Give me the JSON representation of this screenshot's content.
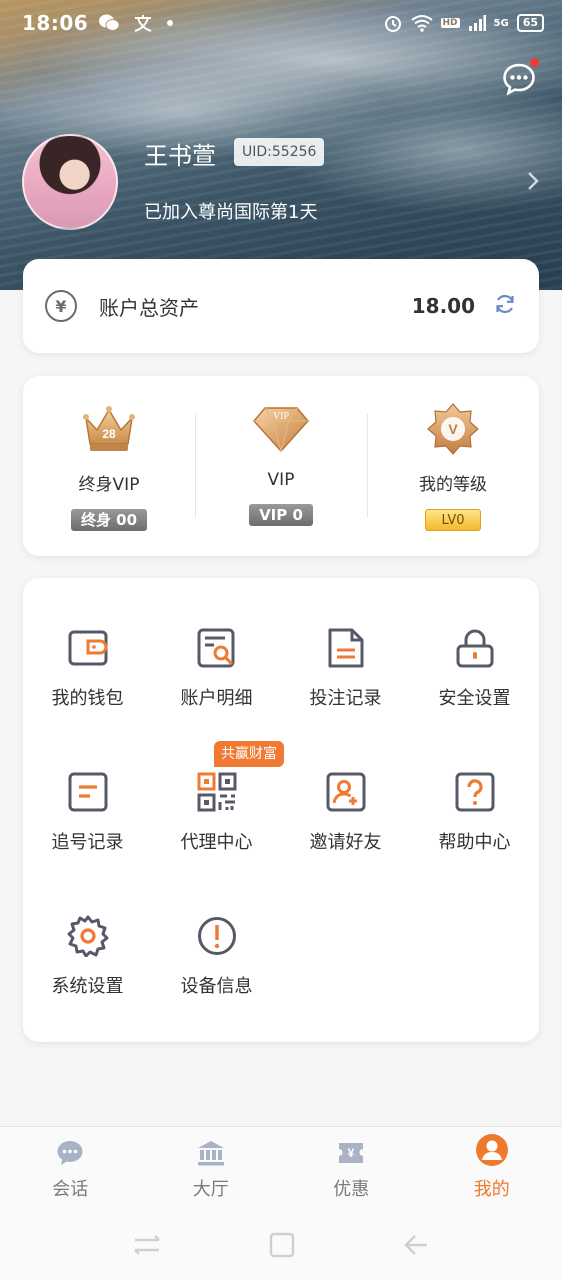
{
  "status_bar": {
    "time": "18:06",
    "network": "5G",
    "battery": "65",
    "hd_label": "HD"
  },
  "profile": {
    "name": "王书萱",
    "uid": "UID:55256",
    "joined_text": "已加入尊尚国际第1天"
  },
  "assets": {
    "label": "账户总资产",
    "value": "18.00",
    "icon": "yen-icon"
  },
  "vip": [
    {
      "label": "终身VIP",
      "badge": "终身 00",
      "icon": "crown-icon",
      "icon_text": "28"
    },
    {
      "label": "VIP",
      "badge": "VIP 0",
      "icon": "diamond-icon",
      "icon_text": "VIP"
    },
    {
      "label": "我的等级",
      "badge": "LV0",
      "icon": "level-badge-icon",
      "icon_text": "V"
    }
  ],
  "menu": {
    "items": [
      {
        "label": "我的钱包",
        "icon": "wallet-icon"
      },
      {
        "label": "账户明细",
        "icon": "account-details-icon"
      },
      {
        "label": "投注记录",
        "icon": "document-icon"
      },
      {
        "label": "安全设置",
        "icon": "lock-icon"
      },
      {
        "label": "追号记录",
        "icon": "chase-record-icon"
      },
      {
        "label": "代理中心",
        "icon": "qr-code-icon",
        "badge": "共赢财富"
      },
      {
        "label": "邀请好友",
        "icon": "invite-user-icon"
      },
      {
        "label": "帮助中心",
        "icon": "help-icon"
      },
      {
        "label": "系统设置",
        "icon": "gear-icon"
      },
      {
        "label": "设备信息",
        "icon": "info-icon"
      }
    ]
  },
  "tabs": [
    {
      "label": "会话",
      "icon": "chat-icon",
      "active": false
    },
    {
      "label": "大厅",
      "icon": "hall-icon",
      "active": false
    },
    {
      "label": "优惠",
      "icon": "coupon-icon",
      "active": false
    },
    {
      "label": "我的",
      "icon": "profile-icon",
      "active": true
    }
  ],
  "colors": {
    "accent": "#ef7a2e",
    "icon_gray": "#555a66",
    "icon_orange": "#f07a33"
  }
}
